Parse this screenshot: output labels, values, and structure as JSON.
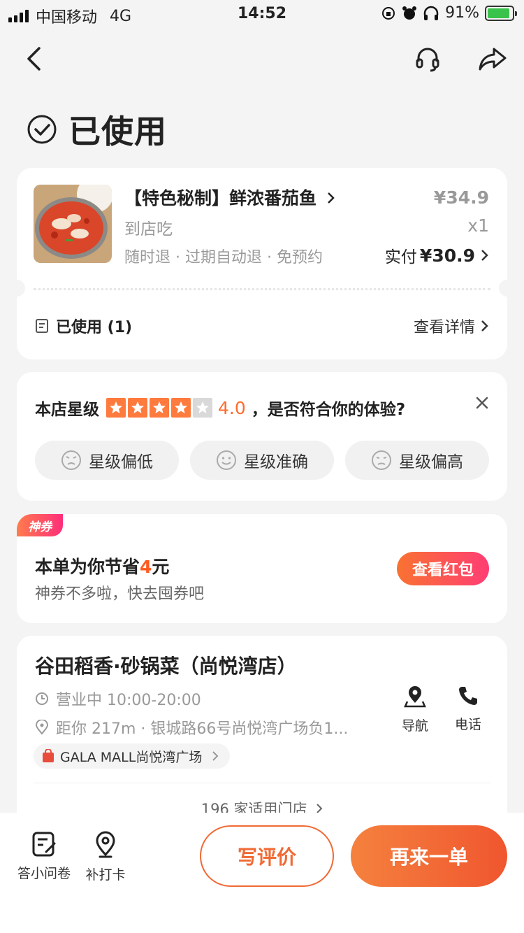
{
  "status_bar": {
    "carrier": "中国移动",
    "network": "4G",
    "time": "14:52",
    "battery": "91%"
  },
  "nav": {
    "back_icon": "chevron-left-icon",
    "service_icon": "headset-icon",
    "share_icon": "share-icon"
  },
  "page": {
    "title": "已使用",
    "status_icon": "check-circle-icon"
  },
  "order": {
    "item_name": "【特色秘制】鲜浓番茄鱼",
    "item_sub": "到店吃",
    "tags": "随时退 · 过期自动退 · 免预约",
    "original_price": "¥34.9",
    "quantity": "x1",
    "paid_label": "实付",
    "paid_amount": "¥30.9",
    "used_label": "已使用 (1)",
    "detail_link": "查看详情"
  },
  "rating": {
    "label": "本店星级",
    "stars": 4,
    "max_stars": 5,
    "value": "4.0",
    "question": "，是否符合你的体验?",
    "options": [
      "星级偏低",
      "星级准确",
      "星级偏高"
    ]
  },
  "coupon": {
    "badge": "神券",
    "title_prefix": "本单为你节省",
    "amount": "4",
    "title_suffix": "元",
    "subtitle": "神券不多啦，快去囤券吧",
    "button": "查看红包",
    "accent": "#ff5a1f"
  },
  "store": {
    "name": "谷田稻香·砂锅菜（尚悦湾店）",
    "hours": "营业中 10:00-20:00",
    "distance": "距你 217m ·  银城路66号尚悦湾广场负1...",
    "mall": "GALA MALL尚悦湾广场",
    "nav_label": "导航",
    "phone_label": "电话",
    "applicable": "196 家适用门店"
  },
  "bottom": {
    "survey": "答小问卷",
    "checkin": "补打卡",
    "review": "写评价",
    "reorder": "再来一单"
  },
  "colors": {
    "brand": "#f0652f",
    "star": "#ff7a3d"
  }
}
